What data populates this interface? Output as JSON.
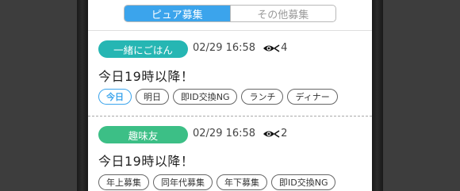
{
  "tabs": [
    {
      "label": "ピュア募集",
      "active": true
    },
    {
      "label": "その他募集",
      "active": false
    }
  ],
  "posts": [
    {
      "category": "一緒にごはん",
      "category_color": "#26b6b3",
      "datetime": "02/29 16:58",
      "view_icon": "eye-icon",
      "views": "4",
      "title": "今日19時以降！",
      "tags": [
        {
          "label": "今日",
          "active": true
        },
        {
          "label": "明日",
          "active": false
        },
        {
          "label": "即ID交換NG",
          "active": false
        },
        {
          "label": "ランチ",
          "active": false
        },
        {
          "label": "ディナー",
          "active": false
        }
      ]
    },
    {
      "category": "趣味友",
      "category_color": "#3cbf86",
      "datetime": "02/29 16:58",
      "view_icon": "eye-icon",
      "views": "2",
      "title": "今日19時以降！",
      "tags": [
        {
          "label": "年上募集",
          "active": false
        },
        {
          "label": "同年代募集",
          "active": false
        },
        {
          "label": "年下募集",
          "active": false
        },
        {
          "label": "即ID交換NG",
          "active": false
        }
      ]
    }
  ],
  "colors": {
    "accent": "#3ba4ec"
  }
}
